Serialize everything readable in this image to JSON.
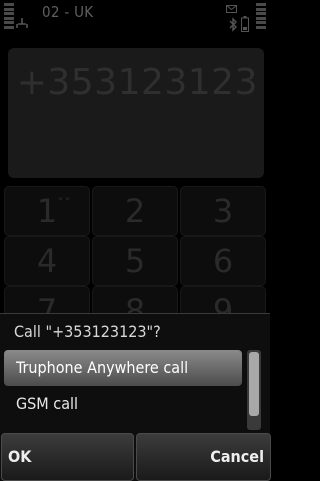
{
  "status_bar": {
    "operator": "02 - UK",
    "signal_icon": "signal-strength-icon",
    "network_icon": "network-icon",
    "message_icon": "envelope-icon",
    "bluetooth_icon": "bluetooth-icon",
    "battery_icon": "battery-icon"
  },
  "dialer": {
    "number": "+353123123",
    "keys": [
      {
        "digit": "1",
        "sub": "ˇˇ"
      },
      {
        "digit": "2",
        "sub": ""
      },
      {
        "digit": "3",
        "sub": ""
      },
      {
        "digit": "4",
        "sub": ""
      },
      {
        "digit": "5",
        "sub": ""
      },
      {
        "digit": "6",
        "sub": ""
      },
      {
        "digit": "7",
        "sub": ""
      },
      {
        "digit": "8",
        "sub": ""
      },
      {
        "digit": "9",
        "sub": ""
      }
    ]
  },
  "dialog": {
    "title": "Call \"+353123123\"?",
    "options": [
      {
        "label": "Truphone Anywhere call",
        "selected": true
      },
      {
        "label": "GSM call",
        "selected": false
      }
    ],
    "ok_label": "OK",
    "cancel_label": "Cancel"
  }
}
